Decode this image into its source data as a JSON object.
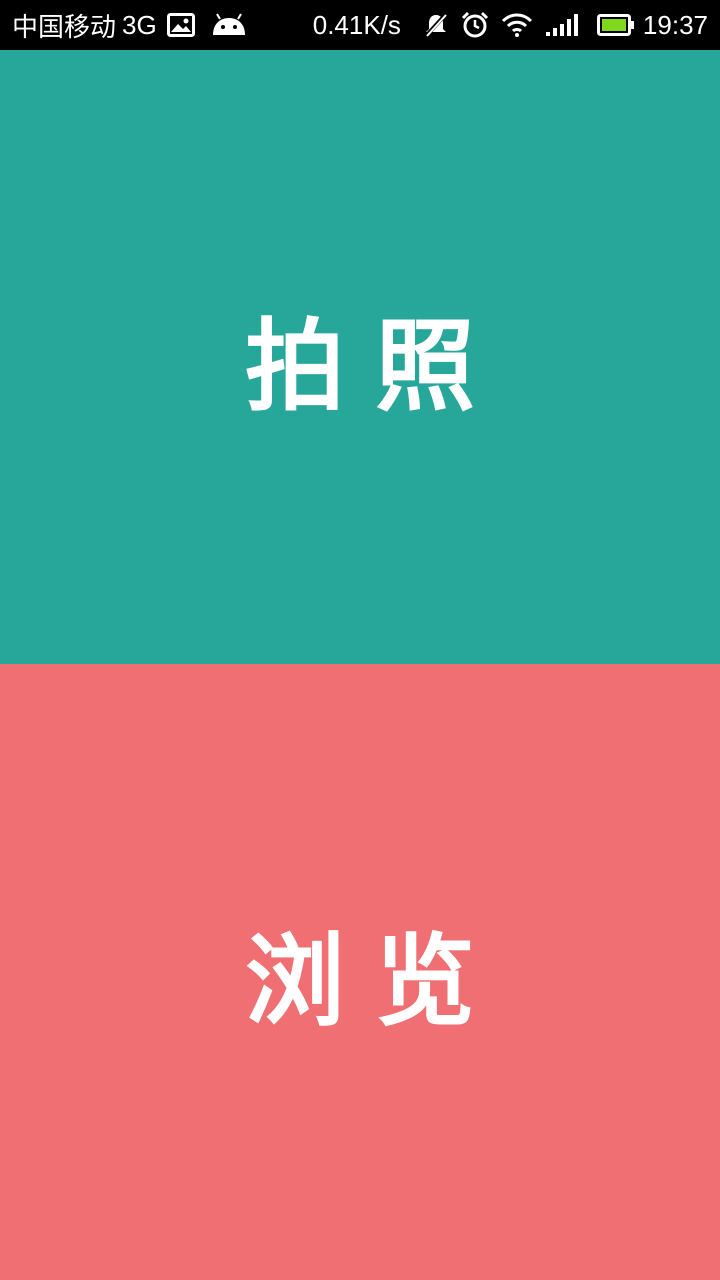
{
  "status_bar": {
    "carrier": "中国移动",
    "network": "3G",
    "speed": "0.41K/s",
    "time": "19:37",
    "icons": [
      "image-icon",
      "android-icon",
      "mute-icon",
      "alarm-icon",
      "wifi-icon",
      "signal-icon",
      "battery-icon"
    ]
  },
  "panels": {
    "top": {
      "label": "拍照",
      "color": "#27A69A"
    },
    "bottom": {
      "label": "浏览",
      "color": "#EF6F72"
    }
  },
  "colors": {
    "battery_fill": "#7FD81E"
  }
}
